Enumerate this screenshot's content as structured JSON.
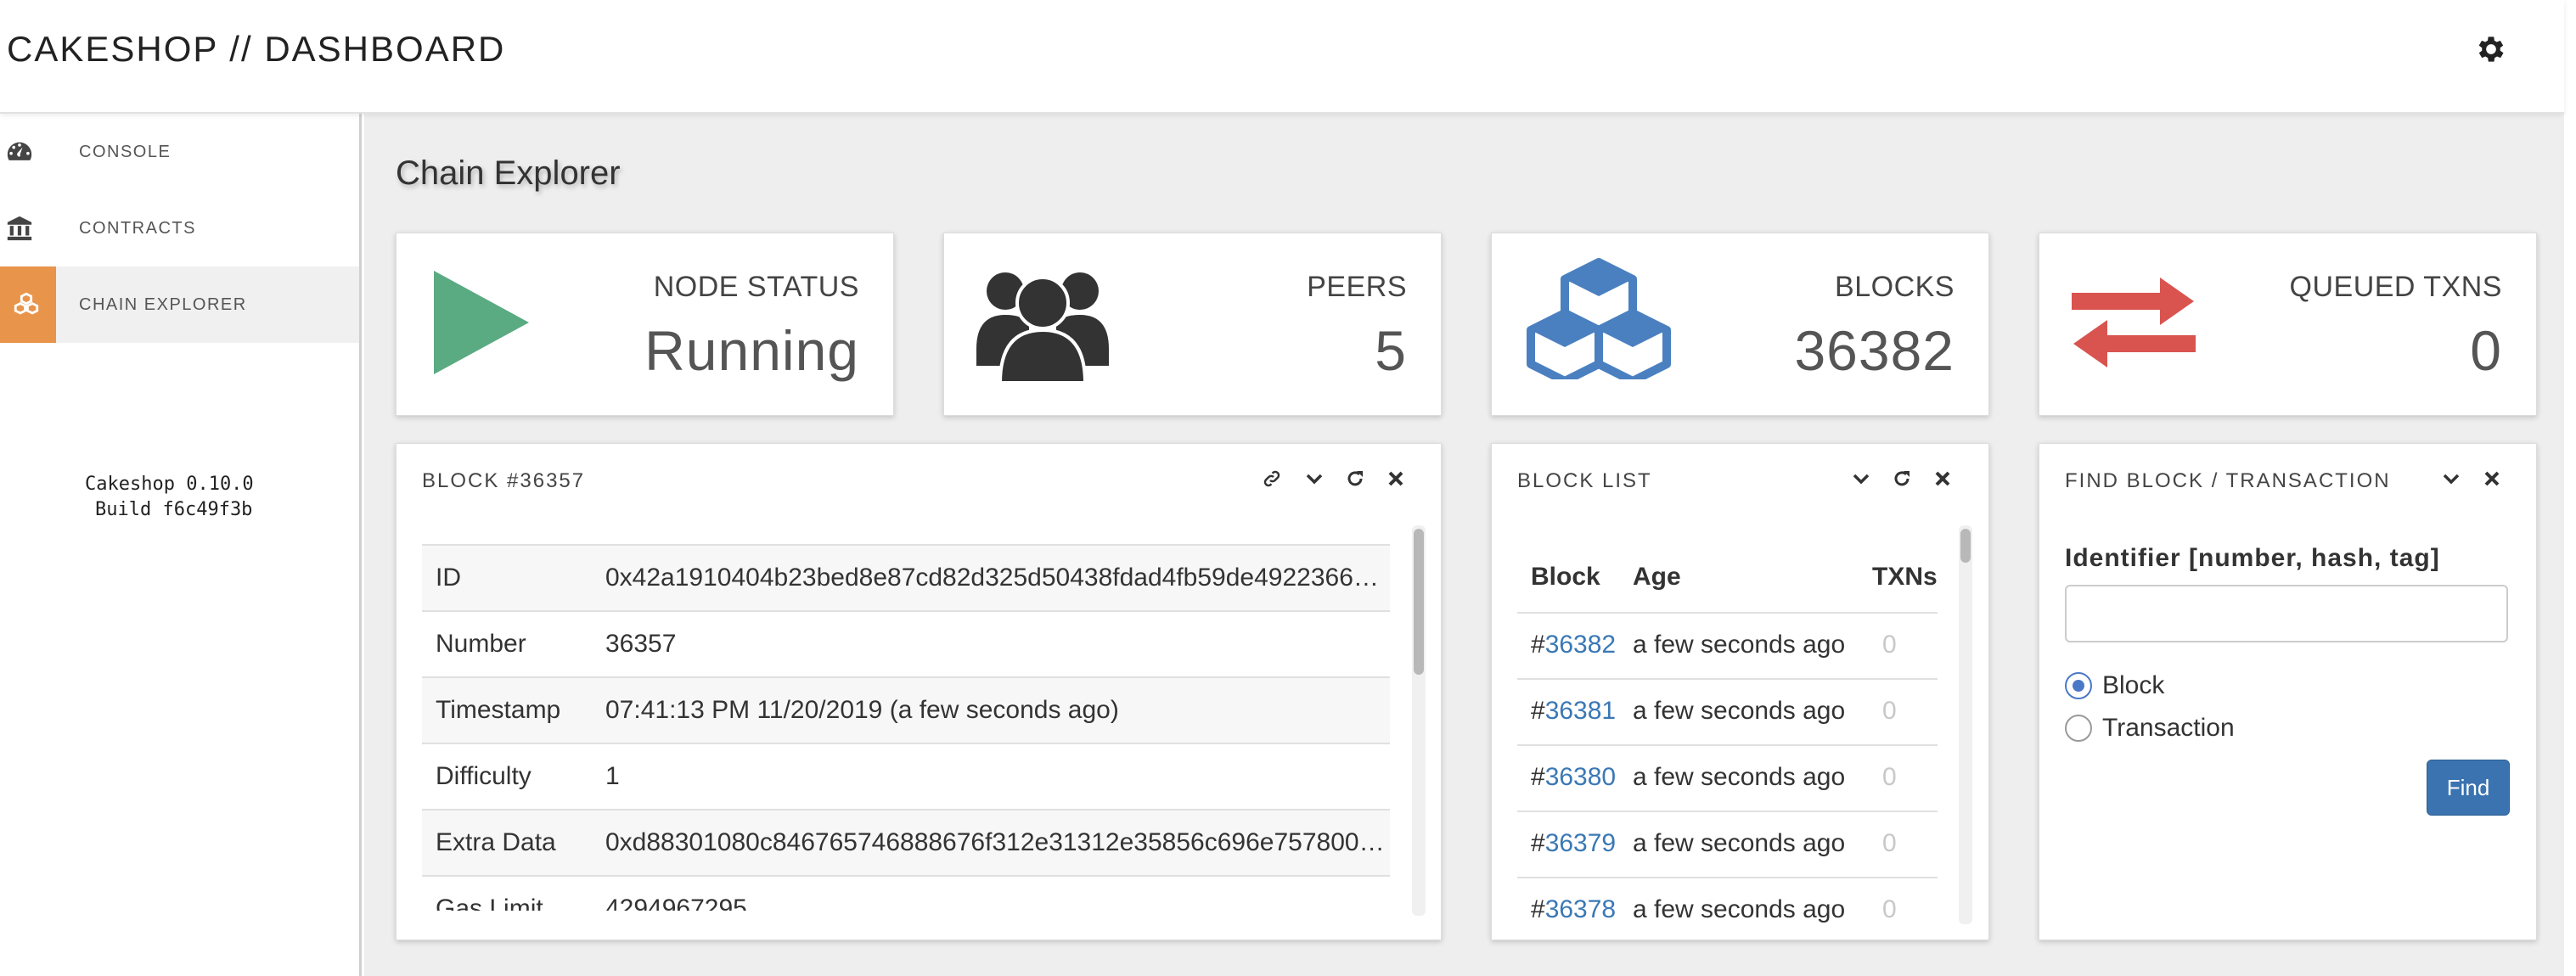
{
  "app": {
    "title": "CAKESHOP // DASHBOARD"
  },
  "sidebar": {
    "items": [
      {
        "label": "CONSOLE",
        "icon": "dashboard-gauge-icon"
      },
      {
        "label": "CONTRACTS",
        "icon": "bank-building-icon"
      },
      {
        "label": "CHAIN EXPLORER",
        "icon": "cubes-icon",
        "active": true
      }
    ],
    "version_line1": "Cakeshop 0.10.0",
    "version_line2": "Build f6c49f3b"
  },
  "page": {
    "title": "Chain Explorer"
  },
  "stats": {
    "node_status": {
      "label": "NODE STATUS",
      "value": "Running",
      "icon": "play-icon",
      "color": "#5aaa82"
    },
    "peers": {
      "label": "PEERS",
      "value": "5",
      "icon": "users-group-icon",
      "color": "#333333"
    },
    "blocks": {
      "label": "BLOCKS",
      "value": "36382",
      "icon": "cubes-icon",
      "color": "#4a80c0"
    },
    "queued_txns": {
      "label": "QUEUED TXNS",
      "value": "0",
      "icon": "exchange-arrows-icon",
      "color": "#d9534f"
    }
  },
  "block_detail": {
    "title": "BLOCK #36357",
    "rows": [
      {
        "key": "ID",
        "value": "0x42a1910404b23bed8e87cd82d325d50438fdad4fb59de49223667e…"
      },
      {
        "key": "Number",
        "value": "36357"
      },
      {
        "key": "Timestamp",
        "value": "07:41:13 PM 11/20/2019 (a few seconds ago)"
      },
      {
        "key": "Difficulty",
        "value": "1"
      },
      {
        "key": "Extra Data",
        "value": "0xd88301080c846765746888676f312e31312e35856c696e7578000…"
      },
      {
        "key": "Gas Limit",
        "value": "4294967295"
      }
    ]
  },
  "block_list": {
    "title": "BLOCK LIST",
    "headers": {
      "block": "Block",
      "age": "Age",
      "txns": "TXNs"
    },
    "rows": [
      {
        "prefix": "#",
        "number": "36382",
        "age": "a few seconds ago",
        "txns": "0"
      },
      {
        "prefix": "#",
        "number": "36381",
        "age": "a few seconds ago",
        "txns": "0"
      },
      {
        "prefix": "#",
        "number": "36380",
        "age": "a few seconds ago",
        "txns": "0"
      },
      {
        "prefix": "#",
        "number": "36379",
        "age": "a few seconds ago",
        "txns": "0"
      },
      {
        "prefix": "#",
        "number": "36378",
        "age": "a few seconds ago",
        "txns": "0"
      }
    ]
  },
  "find": {
    "title": "FIND BLOCK / TRANSACTION",
    "label": "Identifier [number, hash, tag]",
    "input_value": "",
    "options": [
      "Block",
      "Transaction"
    ],
    "selected": "Block",
    "button": "Find"
  }
}
